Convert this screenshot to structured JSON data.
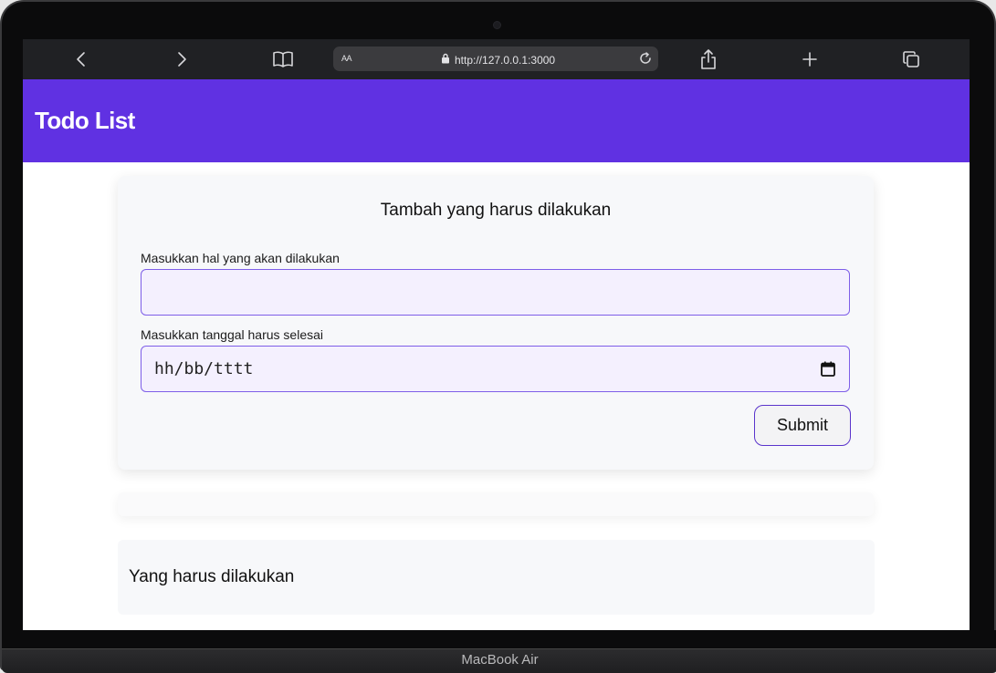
{
  "browser": {
    "reader_aa": "AA",
    "url": "http://127.0.0.1:3000",
    "toolbar_icons": [
      "chevron-left-icon",
      "chevron-right-icon",
      "book-icon",
      "lock-icon",
      "reload-icon",
      "share-icon",
      "plus-icon",
      "tabs-icon"
    ]
  },
  "app": {
    "title": "Todo List",
    "accent_color": "#6031e2",
    "form": {
      "heading": "Tambah yang harus dilakukan",
      "todo_label": "Masukkan hal yang akan dilakukan",
      "todo_value": "",
      "date_label": "Masukkan tanggal harus selesai",
      "date_placeholder": "hh/bb/tttt",
      "submit_label": "Submit"
    },
    "todo_section_title": "Yang harus dilakukan"
  },
  "device": {
    "label": "MacBook Air"
  }
}
